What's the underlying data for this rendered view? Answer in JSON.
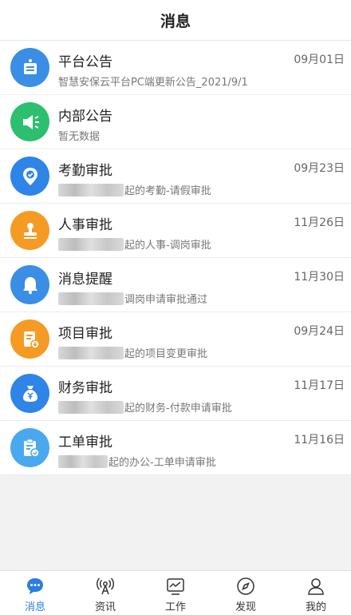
{
  "header": {
    "title": "消息"
  },
  "colors": {
    "blue": "#3a8ee6",
    "green": "#2cbf70",
    "orange": "#f59a23",
    "light_blue": "#4aa8ef",
    "active_tab": "#2a7de1"
  },
  "messages": [
    {
      "title": "平台公告",
      "date": "09月01日",
      "prefix": "",
      "subtitle": "智慧安保云平台PC端更新公告_2021/9/1",
      "icon": "notice-board-icon",
      "color": "#3a8ee6"
    },
    {
      "title": "内部公告",
      "date": "",
      "prefix": "",
      "subtitle": "暂无数据",
      "icon": "megaphone-icon",
      "color": "#2cbf70"
    },
    {
      "title": "考勤审批",
      "date": "09月23日",
      "prefix": "blurred",
      "subtitle": "起的考勤-请假审批",
      "icon": "location-check-icon",
      "color": "#2f84e8"
    },
    {
      "title": "人事审批",
      "date": "11月26日",
      "prefix": "blurred",
      "subtitle": "起的人事-调岗审批",
      "icon": "stamp-icon",
      "color": "#f59a23"
    },
    {
      "title": "消息提醒",
      "date": "11月30日",
      "prefix": "blurred",
      "subtitle": "调岗申请审批通过",
      "icon": "bell-icon",
      "color": "#3a8ee6"
    },
    {
      "title": "项目审批",
      "date": "09月24日",
      "prefix": "blurred",
      "subtitle": "起的项目变更审批",
      "icon": "document-download-icon",
      "color": "#f59a23"
    },
    {
      "title": "财务审批",
      "date": "11月17日",
      "prefix": "blurred",
      "subtitle": "起的财务-付款申请审批",
      "icon": "money-bag-icon",
      "color": "#2f84e8"
    },
    {
      "title": "工单审批",
      "date": "11月16日",
      "prefix": "blurred",
      "subtitle": "起的办公-工单申请审批",
      "icon": "clipboard-check-icon",
      "color": "#4aa8ef"
    }
  ],
  "tabs": [
    {
      "label": "消息",
      "icon": "chat-bubble-icon",
      "active": true
    },
    {
      "label": "资讯",
      "icon": "broadcast-icon",
      "active": false
    },
    {
      "label": "工作",
      "icon": "chart-monitor-icon",
      "active": false
    },
    {
      "label": "发现",
      "icon": "compass-icon",
      "active": false
    },
    {
      "label": "我的",
      "icon": "user-icon",
      "active": false
    }
  ]
}
